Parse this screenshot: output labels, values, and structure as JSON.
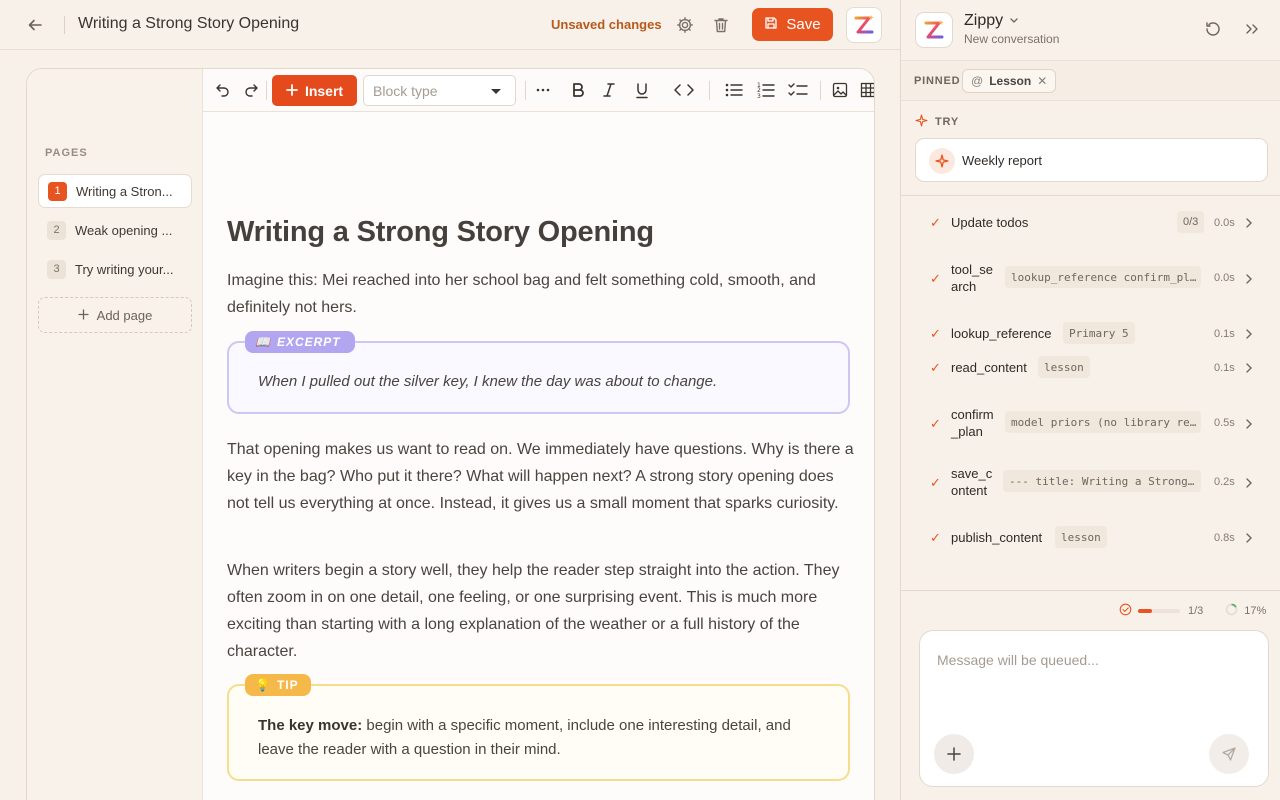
{
  "header": {
    "title": "Writing a Strong Story Opening",
    "unsaved": "Unsaved changes",
    "save_label": "Save"
  },
  "pages": {
    "label": "PAGES",
    "items": [
      {
        "num": "1",
        "label": "Writing a Stron..."
      },
      {
        "num": "2",
        "label": "Weak opening ..."
      },
      {
        "num": "3",
        "label": "Try writing your..."
      }
    ],
    "add_label": "Add page"
  },
  "toolbar": {
    "insert_label": "Insert",
    "block_type_placeholder": "Block type"
  },
  "doc": {
    "heading": "Writing a Strong Story Opening",
    "p1": "Imagine this: Mei reached into her school bag and felt something cold, smooth, and definitely not hers.",
    "excerpt_tag": "EXCERPT",
    "excerpt_icon": "📖",
    "excerpt_text": "When I pulled out the silver key, I knew the day was about to change.",
    "p2": "That opening makes us want to read on. We immediately have questions. Why is there a key in the bag? Who put it there? What will happen next? A strong story opening does not tell us everything at once. Instead, it gives us a small moment that sparks curiosity.",
    "p3": "When writers begin a story well, they help the reader step straight into the action. They often zoom in on one detail, one feeling, or one surprising event. This is much more exciting than starting with a long explanation of the weather or a full history of the character.",
    "tip_tag": "TIP",
    "tip_icon": "💡",
    "tip_bold": "The key move:",
    "tip_text": " begin with a specific moment, include one interesting detail, and leave the reader with a question in their mind."
  },
  "assistant": {
    "name": "Zippy",
    "subtitle": "New conversation",
    "pinned_label": "PINNED",
    "pinned_chip_prefix": "@",
    "pinned_chip": "Lesson",
    "try_label": "TRY",
    "try_card": "Weekly report",
    "tools": [
      {
        "name": "Update todos",
        "arg": "0/3",
        "time": "0.0s"
      },
      {
        "name_line1": "tool_se",
        "name_line2": "arch",
        "arg": "lookup_reference confirm_pl…",
        "time": "0.0s"
      },
      {
        "name": "lookup_reference",
        "arg": "Primary 5",
        "time": "0.1s"
      },
      {
        "name": "read_content",
        "arg": "lesson",
        "time": "0.1s"
      },
      {
        "name_line1": "confirm",
        "name_line2": "_plan",
        "arg": "model priors (no library re…",
        "time": "0.5s"
      },
      {
        "name_line1": "save_c",
        "name_line2": "ontent",
        "arg": "--- title: Writing a Strong…",
        "time": "0.2s"
      },
      {
        "name": "publish_content",
        "arg": "lesson",
        "time": "0.8s"
      }
    ],
    "progress_text": "1/3",
    "progress_fraction": 0.33,
    "context_text": "17%",
    "context_fraction": 0.17,
    "message_placeholder": "Message will be queued..."
  },
  "colors": {
    "accent": "#e8541f",
    "excerpt": "#b3a6f0",
    "tip": "#f5b949"
  }
}
